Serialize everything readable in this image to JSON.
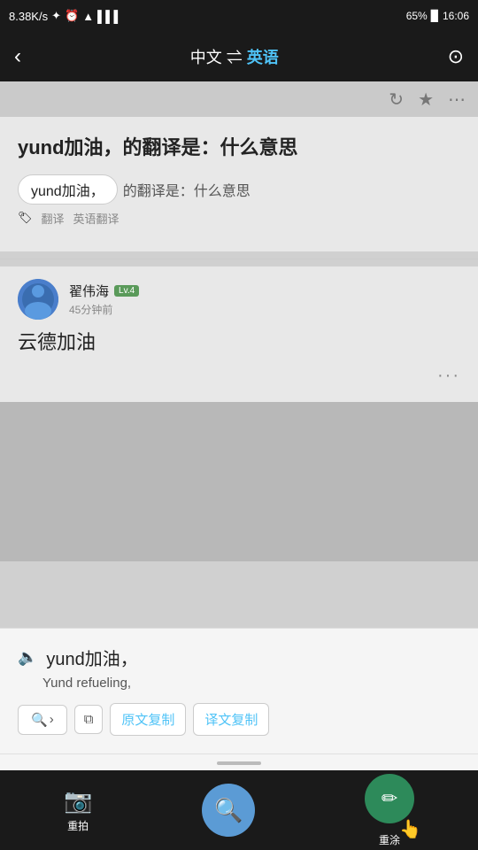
{
  "statusBar": {
    "speed": "8.38K/s",
    "time": "16:06",
    "battery": "65%"
  },
  "navBar": {
    "backLabel": "‹",
    "title": "中文  ⇌  英语",
    "moreLabel": "⊙"
  },
  "secondaryIcons": [
    "⟳",
    "★",
    "⋯"
  ],
  "mainContent": {
    "questionTitle": "yund加油，的翻译是：什么意思",
    "highlightedPhrase": "yund加油，",
    "phraseRest": "的翻译是：什么意思",
    "tagTranslate": "翻译",
    "tagEnglish": "英语翻译"
  },
  "answer": {
    "userName": "翟伟海",
    "userBadge": "Lv.4",
    "userTime": "45分钟前",
    "answerText": "云德加油",
    "moreDots": "···"
  },
  "translationPanel": {
    "originalText": "yund加油，",
    "translatedText": "Yund refueling,",
    "searchLabel": "🔍 ›",
    "copyIconLabel": "⧉",
    "copyOriginalLabel": "原文复制",
    "copyTranslationLabel": "译文复制"
  },
  "bottomNav": {
    "retakeLabel": "重拍",
    "retakeIcon": "📷",
    "searchIcon": "🔍",
    "editLabel": "重涂",
    "editIcon": "✏"
  }
}
